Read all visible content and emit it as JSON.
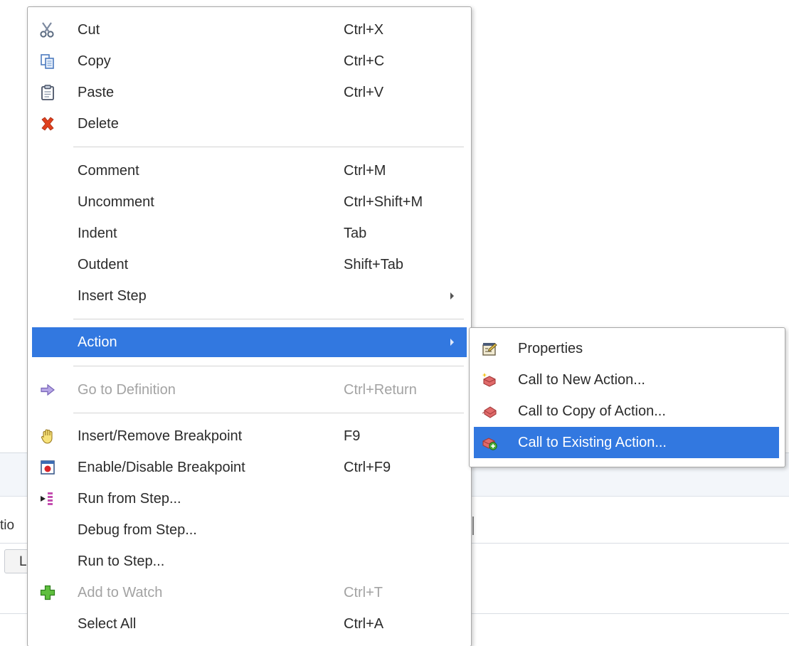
{
  "background": {
    "left_fragment_text": "tio",
    "button_fragment_text": "L"
  },
  "colors": {
    "highlight": "#3278e0",
    "disabled_text": "#a3a3a3",
    "text": "#2b2b2b"
  },
  "context_menu": {
    "items": [
      {
        "label": "Cut",
        "shortcut": "Ctrl+X",
        "icon": "scissors-icon"
      },
      {
        "label": "Copy",
        "shortcut": "Ctrl+C",
        "icon": "copy-icon"
      },
      {
        "label": "Paste",
        "shortcut": "Ctrl+V",
        "icon": "clipboard-icon"
      },
      {
        "label": "Delete",
        "shortcut": "",
        "icon": "red-x-icon"
      },
      {
        "label": "Comment",
        "shortcut": "Ctrl+M"
      },
      {
        "label": "Uncomment",
        "shortcut": "Ctrl+Shift+M"
      },
      {
        "label": "Indent",
        "shortcut": "Tab"
      },
      {
        "label": "Outdent",
        "shortcut": "Shift+Tab"
      },
      {
        "label": "Insert Step",
        "shortcut": "",
        "submenu": true
      },
      {
        "label": "Action",
        "shortcut": "",
        "submenu": true,
        "highlighted": true
      },
      {
        "label": "Go to Definition",
        "shortcut": "Ctrl+Return",
        "icon": "arrow-right-icon",
        "disabled": true
      },
      {
        "label": "Insert/Remove Breakpoint",
        "shortcut": "F9",
        "icon": "hand-icon"
      },
      {
        "label": "Enable/Disable Breakpoint",
        "shortcut": "Ctrl+F9",
        "icon": "breakpoint-icon"
      },
      {
        "label": "Run from Step...",
        "shortcut": "",
        "icon": "run-from-step-icon"
      },
      {
        "label": "Debug from Step...",
        "shortcut": ""
      },
      {
        "label": "Run to Step...",
        "shortcut": ""
      },
      {
        "label": "Add to Watch",
        "shortcut": "Ctrl+T",
        "icon": "green-plus-icon",
        "disabled": true
      },
      {
        "label": "Select All",
        "shortcut": "Ctrl+A"
      }
    ]
  },
  "action_submenu": {
    "items": [
      {
        "label": "Properties",
        "icon": "properties-icon"
      },
      {
        "label": "Call to New Action...",
        "icon": "new-action-icon"
      },
      {
        "label": "Call to Copy of Action...",
        "icon": "copy-action-icon"
      },
      {
        "label": "Call to Existing Action...",
        "icon": "existing-action-icon",
        "highlighted": true
      }
    ]
  }
}
